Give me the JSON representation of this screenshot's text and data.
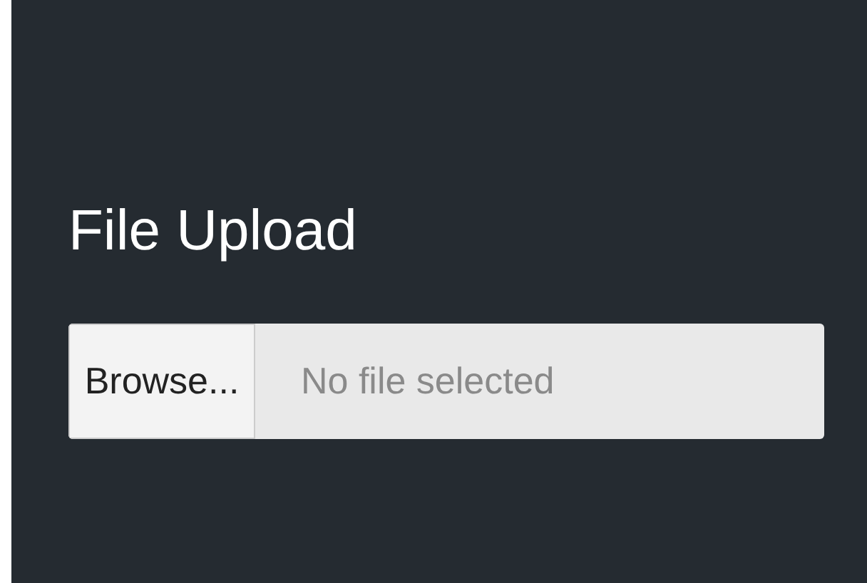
{
  "heading": "File Upload",
  "file_input": {
    "button": "Browse...",
    "placeholder": "No file selected"
  }
}
